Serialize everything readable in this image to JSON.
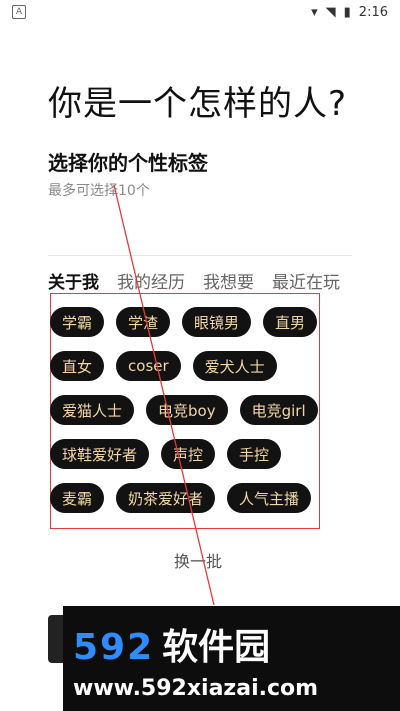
{
  "status_bar": {
    "time": "2:16",
    "left_icon": "notification-icon",
    "right_icons": [
      "wifi-icon",
      "signal-icon",
      "battery-icon"
    ]
  },
  "main": {
    "title": "你是一个怎样的人?",
    "subtitle": "选择你的个性标签",
    "hint": "最多可选择10个"
  },
  "tabs": [
    {
      "label": "关于我",
      "active": true
    },
    {
      "label": "我的经历",
      "active": false
    },
    {
      "label": "我想要",
      "active": false
    },
    {
      "label": "最近在玩",
      "active": false
    }
  ],
  "tags": [
    [
      "学霸",
      "学渣",
      "眼镜男",
      "直男"
    ],
    [
      "直女",
      "coser",
      "爱犬人士"
    ],
    [
      "爱猫人士",
      "电竞boy",
      "电竞girl"
    ],
    [
      "球鞋爱好者",
      "声控",
      "手控"
    ],
    [
      "麦霸",
      "奶茶爱好者",
      "人气主播"
    ]
  ],
  "actions": {
    "refresh_label": "换一批"
  },
  "watermark": {
    "brand_number": "592",
    "brand_cn": "软件园",
    "url": "www.592xiazai.com"
  },
  "colors": {
    "tag_bg": "#121212",
    "tag_text": "#f2d7a5",
    "highlight_box": "#e23b3b",
    "watermark_blue": "#2f8cff"
  }
}
